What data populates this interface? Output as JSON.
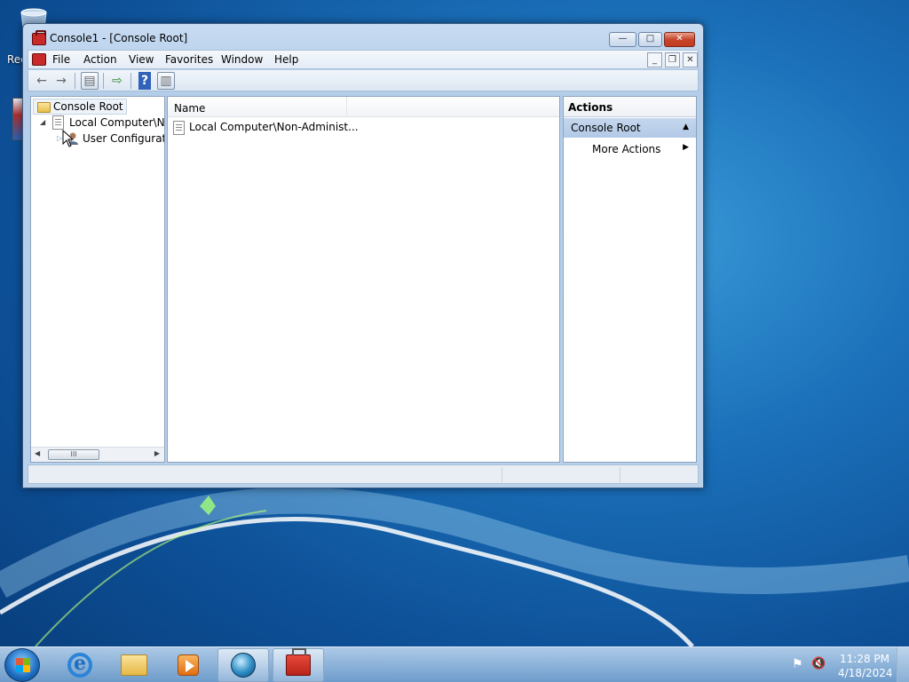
{
  "desktop": {
    "recycle_label": "Rec"
  },
  "window": {
    "title": "Console1 - [Console Root]",
    "caption": {
      "minimize": "—",
      "maximize": "□",
      "close": "✕"
    },
    "mdi": {
      "minimize": "_",
      "restore": "❐",
      "close": "✕"
    }
  },
  "menu": [
    "File",
    "Action",
    "View",
    "Favorites",
    "Window",
    "Help"
  ],
  "toolbar": {
    "back": "←",
    "forward": "→",
    "show_tree": "▤",
    "export": "⇨",
    "help": "?",
    "show_actions": "▥"
  },
  "tree": {
    "root": "Console Root",
    "child": "Local Computer\\Non-Administrators Policy",
    "grandchild": "User Configuration",
    "expand_open": "◢",
    "expand_closed": "▷",
    "scroll_left": "◀",
    "scroll_right": "▶",
    "thumb_grip": "III"
  },
  "list": {
    "column_name": "Name",
    "rows": [
      "Local Computer\\Non-Administ..."
    ]
  },
  "actions": {
    "title": "Actions",
    "section": "Console Root",
    "collapse": "▲",
    "item": "More Actions",
    "arrow": "▶"
  },
  "taskbar": {
    "time": "11:28 PM",
    "date": "4/18/2024",
    "tray_flag": "⚑",
    "tray_speaker": "🔇"
  }
}
